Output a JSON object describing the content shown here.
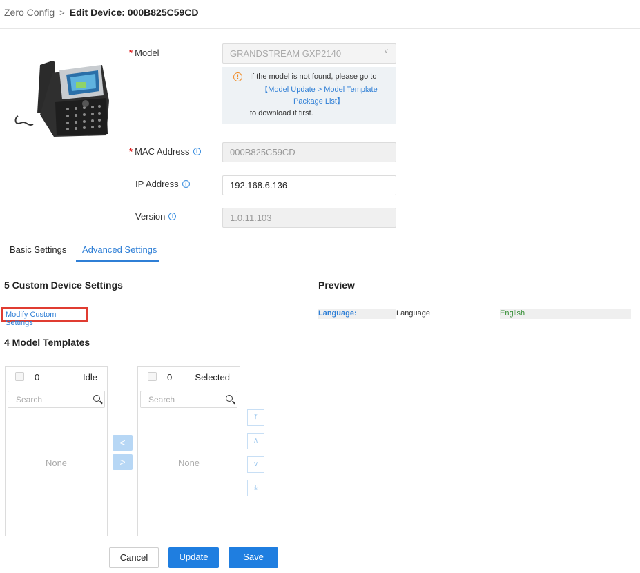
{
  "breadcrumb": {
    "parent": "Zero Config",
    "separator": ">",
    "current": "Edit Device: 000B825C59CD"
  },
  "device_form": {
    "model": {
      "label": "Model",
      "value": "GRANDSTREAM GXP2140",
      "required": true
    },
    "model_hint": {
      "line1": "If the model is not found, please go to",
      "link": "【Model Update > Model Template Package List】",
      "line3": "to download it first."
    },
    "mac": {
      "label": "MAC Address",
      "value": "000B825C59CD",
      "required": true
    },
    "ip": {
      "label": "IP Address",
      "value": "192.168.6.136"
    },
    "version": {
      "label": "Version",
      "value": "1.0.11.103"
    }
  },
  "tabs": [
    {
      "label": "Basic Settings",
      "active": false
    },
    {
      "label": "Advanced Settings",
      "active": true
    }
  ],
  "custom_settings": {
    "title": "5 Custom Device Settings",
    "modify_label": "Modify Custom Settings"
  },
  "preview": {
    "title": "Preview",
    "label": "Language:",
    "key": "Language",
    "value": "English"
  },
  "model_templates": {
    "title": "4 Model Templates",
    "left": {
      "count": "0",
      "title": "Idle",
      "search_placeholder": "Search",
      "empty": "None"
    },
    "right": {
      "count": "0",
      "title": "Selected",
      "search_placeholder": "Search",
      "empty": "None"
    },
    "move_left": "<",
    "move_right": ">",
    "sort": {
      "top": "⤒",
      "up": "∧",
      "down": "∨",
      "bottom": "⤓"
    }
  },
  "footer": {
    "cancel": "Cancel",
    "update": "Update",
    "save": "Save"
  },
  "colors": {
    "accent": "#1f7ee0",
    "link": "#2f7fd6",
    "required": "#e02020",
    "highlight_border": "#e03c31",
    "preview_value": "#2e8b2e"
  },
  "icons": {
    "search": "search-icon",
    "info": "info-icon",
    "warning": "warning-icon",
    "chevron": "chevron-down-icon"
  }
}
